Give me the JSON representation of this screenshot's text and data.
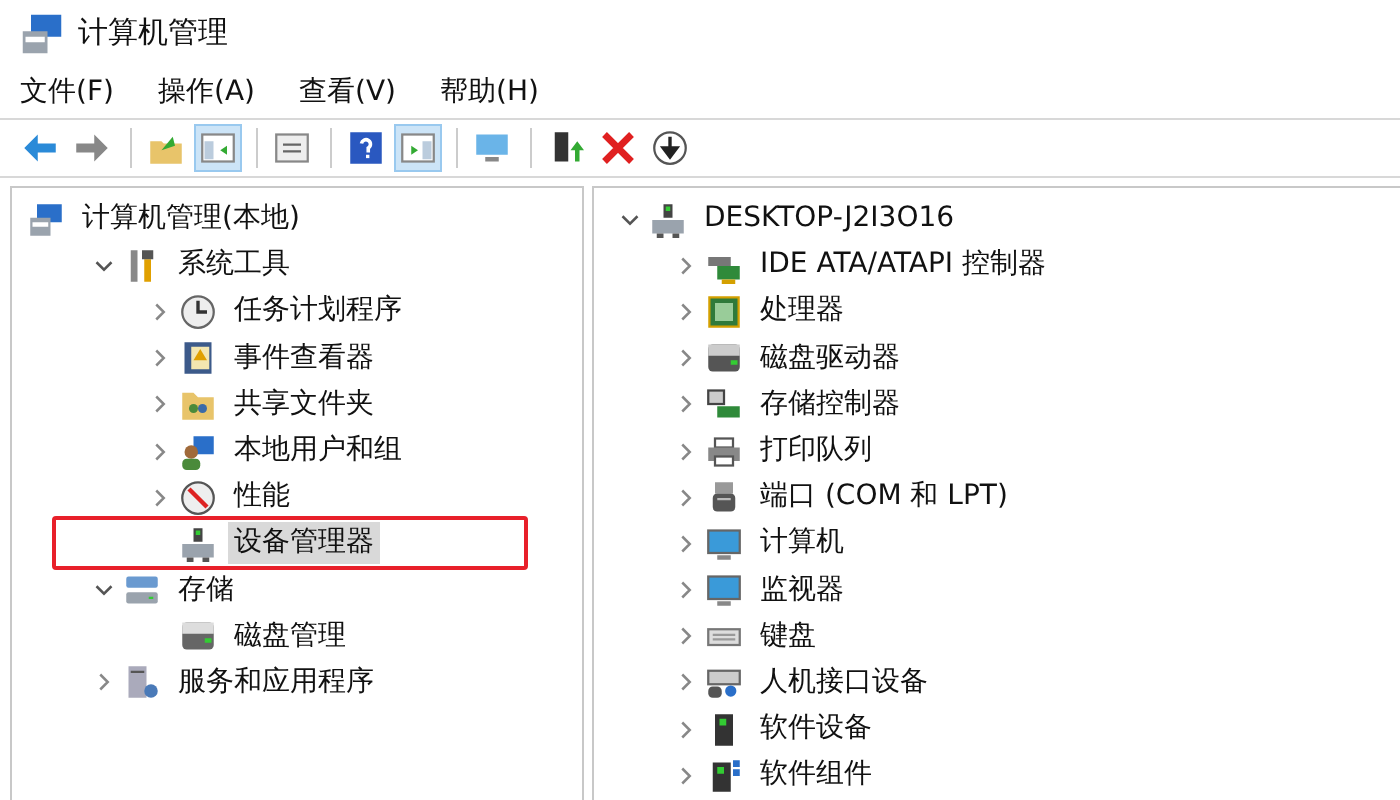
{
  "window": {
    "title": "计算机管理"
  },
  "menu": [
    "文件(F)",
    "操作(A)",
    "查看(V)",
    "帮助(H)"
  ],
  "toolbar": [
    {
      "pressed": false
    },
    {
      "pressed": false
    },
    {
      "pressed": false
    },
    {
      "pressed": true
    },
    {
      "pressed": false
    },
    {
      "pressed": false
    },
    {
      "pressed": true
    },
    {
      "pressed": false
    },
    {
      "pressed": false
    },
    {
      "pressed": false
    },
    {
      "pressed": false
    }
  ],
  "left_tree": [
    {
      "label": "计算机管理(本地)",
      "selected": false,
      "children": [
        {
          "label": "系统工具",
          "expanded": true,
          "selected": false,
          "children": [
            {
              "label": "任务计划程序",
              "expanded": false,
              "selected": false
            },
            {
              "label": "事件查看器",
              "expanded": false,
              "selected": false
            },
            {
              "label": "共享文件夹",
              "expanded": false,
              "selected": false
            },
            {
              "label": "本地用户和组",
              "expanded": false,
              "selected": false
            },
            {
              "label": "性能",
              "expanded": false,
              "selected": false
            },
            {
              "label": "设备管理器",
              "selected": true,
              "highlighted": true
            }
          ]
        },
        {
          "label": "存储",
          "expanded": true,
          "selected": false,
          "children": [
            {
              "label": "磁盘管理",
              "selected": false
            }
          ]
        },
        {
          "label": "服务和应用程序",
          "expanded": false,
          "selected": false
        }
      ]
    }
  ],
  "right_tree": [
    {
      "label": "DESKTOP-J2I3O16",
      "expanded": true,
      "selected": false,
      "children": [
        {
          "label": "IDE ATA/ATAPI 控制器",
          "expanded": false,
          "selected": false
        },
        {
          "label": "处理器",
          "expanded": false,
          "selected": false
        },
        {
          "label": "磁盘驱动器",
          "expanded": false,
          "selected": false
        },
        {
          "label": "存储控制器",
          "expanded": false,
          "selected": false
        },
        {
          "label": "打印队列",
          "expanded": false,
          "selected": false
        },
        {
          "label": "端口 (COM 和 LPT)",
          "expanded": false,
          "selected": false
        },
        {
          "label": "计算机",
          "expanded": false,
          "selected": false
        },
        {
          "label": "监视器",
          "expanded": false,
          "selected": false
        },
        {
          "label": "键盘",
          "expanded": false,
          "selected": false
        },
        {
          "label": "人机接口设备",
          "expanded": false,
          "selected": false
        },
        {
          "label": "软件设备",
          "expanded": false,
          "selected": false
        },
        {
          "label": "软件组件",
          "expanded": false,
          "selected": false
        }
      ]
    }
  ]
}
